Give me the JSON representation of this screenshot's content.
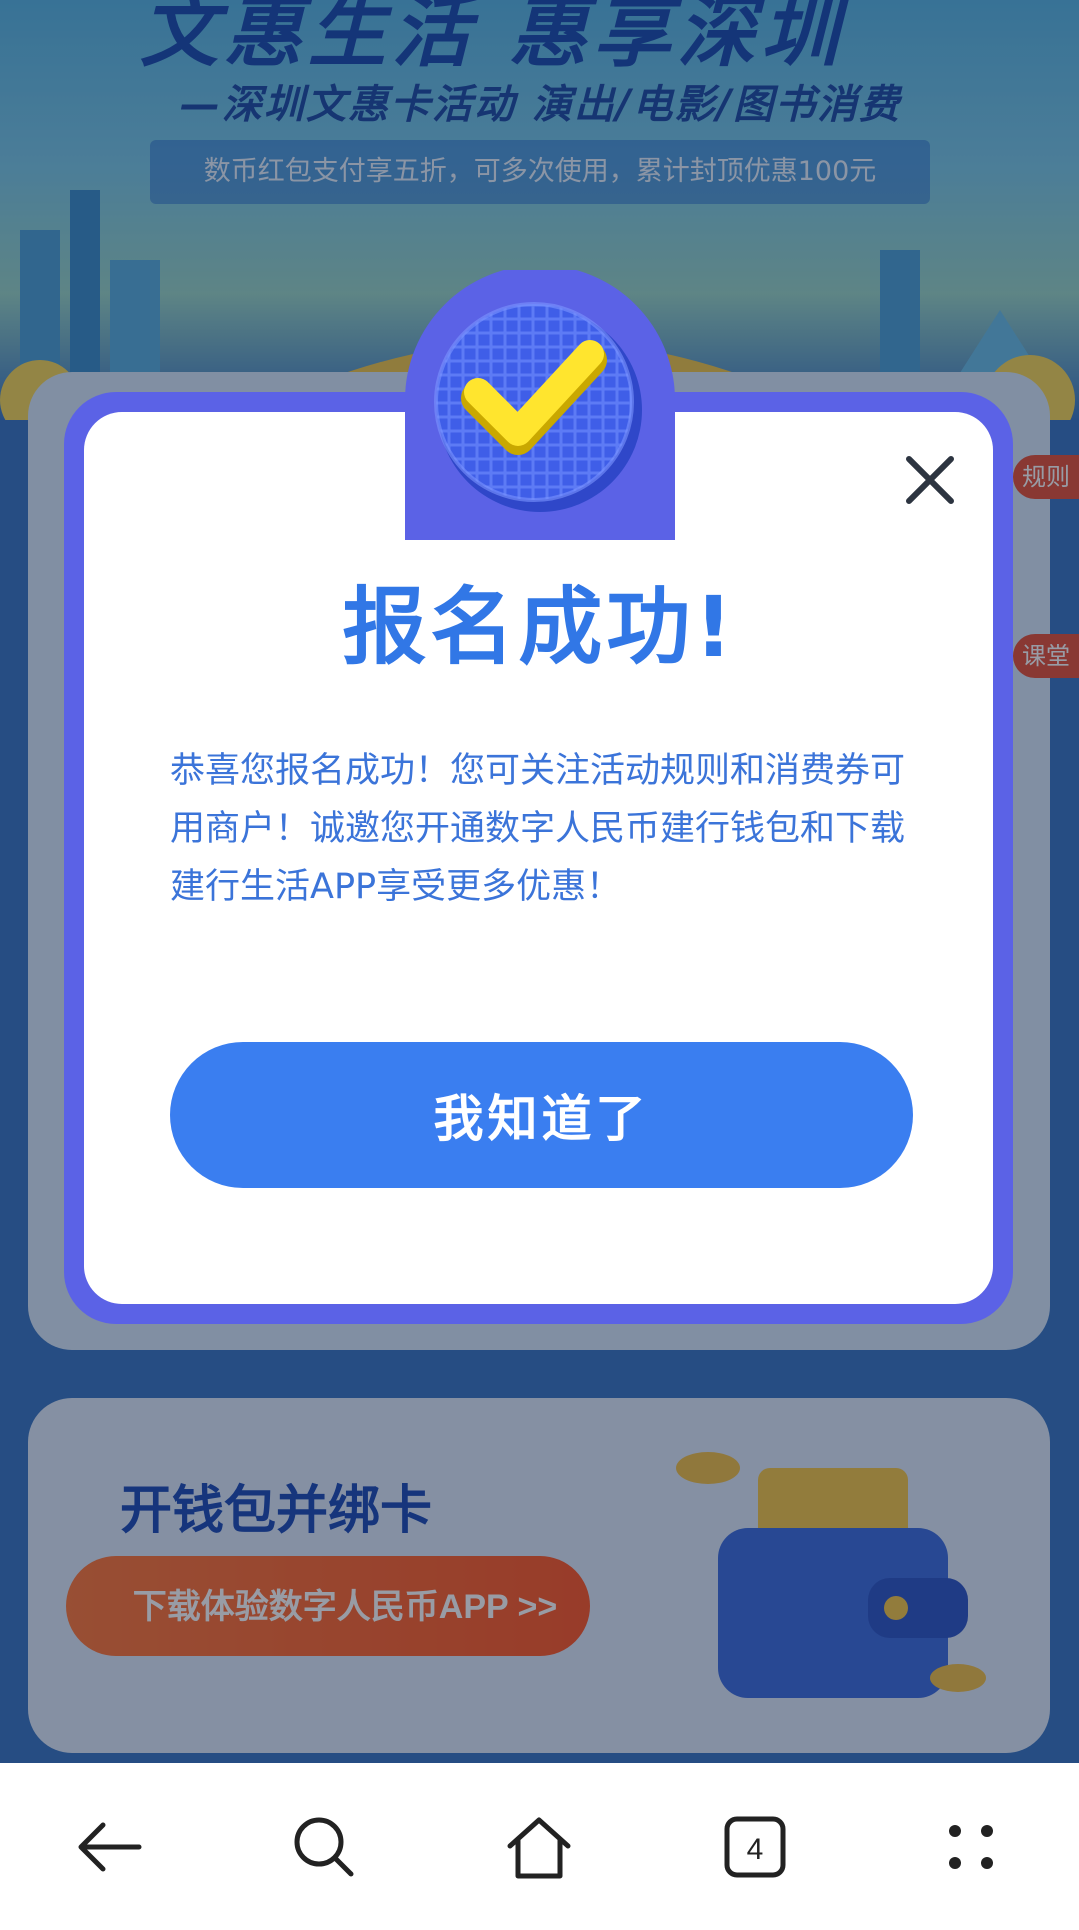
{
  "background": {
    "banner_title": "文惠生活 惠享深圳",
    "banner_subtitle": "—深圳文惠卡活动 演出/电影/图书消费",
    "banner_strip": "数币红包支付享五折，可多次使用，累计封顶优惠100元",
    "side_tags": [
      "规则",
      "课堂"
    ],
    "card2_title": "开钱包并绑卡",
    "card2_button": "下载体验数字人民币APP >>"
  },
  "modal": {
    "title": "报名成功!",
    "message": "恭喜您报名成功！您可关注活动规则和消费券可用商户！诚邀您开通数字人民币建行钱包和下载建行生活APP享受更多优惠！",
    "ok_button": "我知道了",
    "icons": {
      "badge": "checkmark-coin-icon",
      "close": "close-icon"
    }
  },
  "navbar": {
    "tab_count": "4",
    "icons": [
      "back-arrow-icon",
      "search-icon",
      "home-icon",
      "tabs-icon",
      "more-icon"
    ]
  },
  "colors": {
    "modal_frame": "#5b62e6",
    "title_blue": "#3177e6",
    "button_blue": "#3a7ef0",
    "orange": "#ff5a2a"
  }
}
